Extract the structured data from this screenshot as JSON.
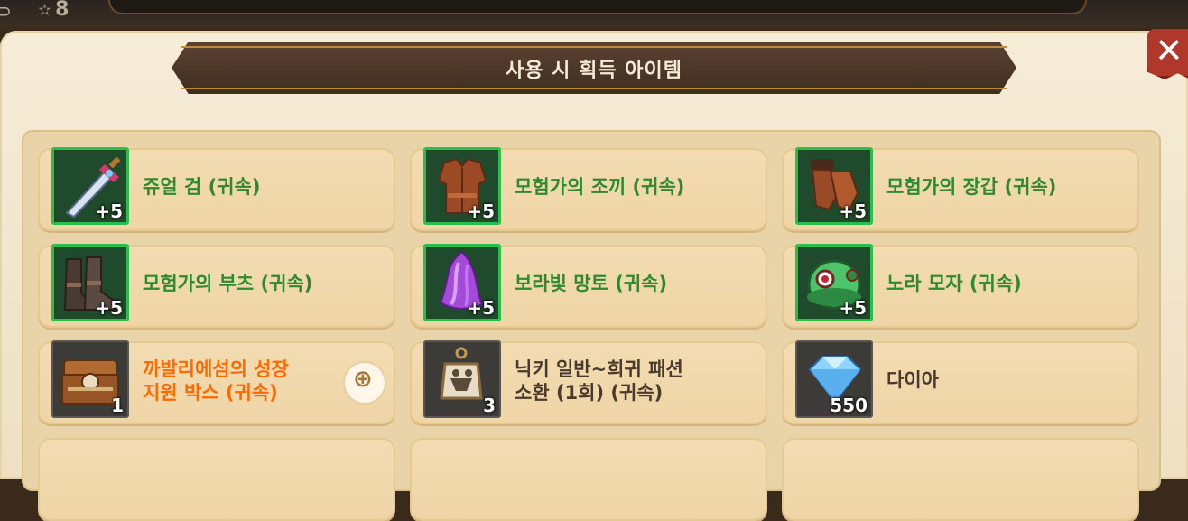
{
  "header": {
    "title": "사용 시 획득 아이템",
    "top_stat_value": "8",
    "top_left_glyph": "⊃",
    "star_glyph": "✫"
  },
  "close_label": "✕",
  "zoom_label": "⊕",
  "items": [
    {
      "name": "쥬얼 검 (귀속)",
      "qty": "+5",
      "color": "green",
      "icon": "sword-icon"
    },
    {
      "name": "모험가의 조끼 (귀속)",
      "qty": "+5",
      "color": "green",
      "icon": "vest-icon"
    },
    {
      "name": "모험가의 장갑 (귀속)",
      "qty": "+5",
      "color": "green",
      "icon": "gloves-icon"
    },
    {
      "name": "모험가의 부츠 (귀속)",
      "qty": "+5",
      "color": "green",
      "icon": "boots-icon"
    },
    {
      "name": "보라빛 망토 (귀속)",
      "qty": "+5",
      "color": "green",
      "icon": "cape-icon"
    },
    {
      "name": "노라 모자 (귀속)",
      "qty": "+5",
      "color": "green",
      "icon": "hat-icon"
    },
    {
      "name_line1": "까발리에섬의 성장",
      "name_line2": "지원 박스 (귀속)",
      "qty": "1",
      "color": "orange",
      "icon": "chest-icon"
    },
    {
      "name_line1": "닉키 일반~희귀 패션",
      "name_line2": "소환 (1회) (귀속)",
      "qty": "3",
      "color": "dark",
      "icon": "summon-lantern-icon"
    },
    {
      "name": "다이아",
      "qty": "550",
      "color": "dark",
      "icon": "diamond-icon"
    }
  ],
  "colors": {
    "green_text": "#2f8a2f",
    "orange_text": "#ff6a00",
    "green_border": "#28c04a",
    "banner": "#4a3628",
    "close": "#b0382b"
  }
}
